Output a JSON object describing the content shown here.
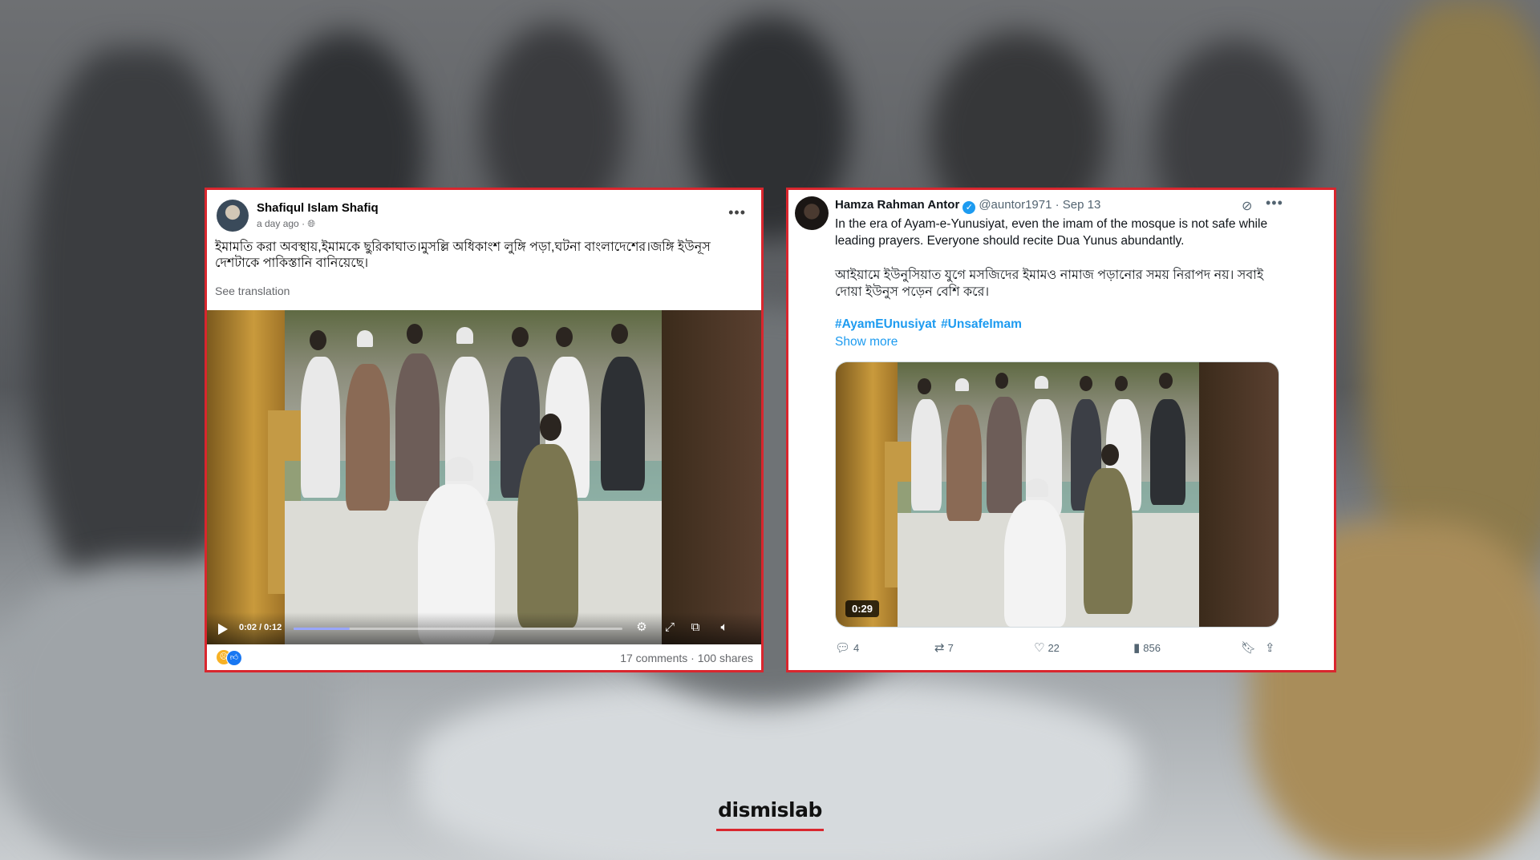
{
  "facebook_post": {
    "author": "Shafiqul Islam Shafiq",
    "timestamp": "a day ago",
    "visibility_icon": "globe-icon",
    "body": "ইমামতি করা অবস্থায়,ইমামকে ছুরিকাঘাত।মুসল্লি অধিকাংশ লুঙ্গি পড়া,ঘটনা বাংলাদেশের।জঙ্গি ইউনূস দেশটাকে পাকিস্তানি বানিয়েছে।",
    "see_translation": "See translation",
    "video": {
      "time": "0:02 / 0:12",
      "progress": 0.17
    },
    "reactions": [
      "sad-reaction-icon",
      "like-reaction-icon"
    ],
    "comments": "17 comments",
    "shares": "100 shares"
  },
  "tweet": {
    "author": "Hamza Rahman Antor",
    "handle": "@auntor1971",
    "date": "· Sep 13",
    "text_en": "In the era of Ayam-e-Yunusiyat, even the imam of the mosque is not safe while leading prayers. Everyone should recite Dua Yunus abundantly.",
    "text_bn": "আইয়ামে ইউনুসিয়াত যুগে মসজিদের ইমামও নামাজ পড়ানোর সময় নিরাপদ নয়। সবাই দোয়া ইউনুস পড়েন বেশি করে।",
    "hashtags": [
      "#AyamEUnusiyat",
      "#UnsafeImam"
    ],
    "show_more": "Show more",
    "video_duration": "0:29",
    "replies": "4",
    "reposts": "7",
    "likes": "22",
    "views": "856"
  },
  "brand": {
    "logo": "dismislab",
    "accent": "#d9262e"
  }
}
